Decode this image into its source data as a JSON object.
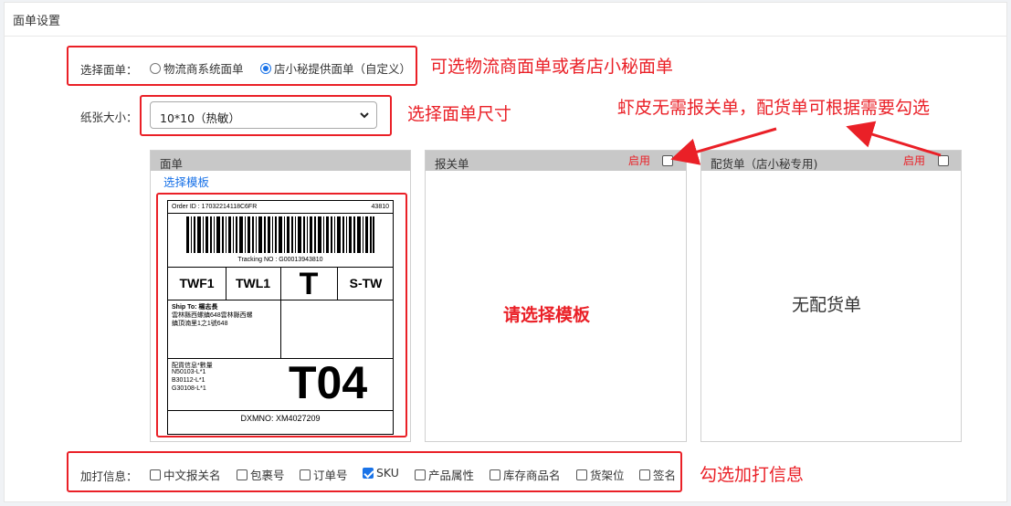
{
  "header": {
    "title": "面单设置"
  },
  "waybill_type": {
    "label": "选择面单：",
    "options": [
      {
        "label": "物流商系统面单",
        "selected": false
      },
      {
        "label": "店小秘提供面单（自定义）",
        "selected": true
      }
    ]
  },
  "paper_size": {
    "label": "纸张大小：",
    "value": "10*10（热敏）"
  },
  "panels": {
    "waybill": {
      "title": "面单",
      "select_template": "选择模板"
    },
    "customs": {
      "title": "报关单",
      "enable": "启用",
      "enabled": false,
      "placeholder": "请选择模板"
    },
    "packing": {
      "title": "配货单（店小秘专用)",
      "enable": "启用",
      "enabled": false,
      "placeholder": "无配货单"
    }
  },
  "label_preview": {
    "order_id": "Order ID : 17032214118C6FR",
    "order_no": "43810",
    "tracking": "Tracking NO : G00013943810",
    "codes": [
      "TWF1",
      "TWL1",
      "T",
      "S-TW"
    ],
    "ship_to_title": "Ship To: 楊志長",
    "ship_to_line1": "雲林縣西螺鎮648雲林縣西螺",
    "ship_to_line2": "鎮頂湳里1之1號648",
    "items_title": "配貨信息*數量",
    "items": [
      "N50103-L*1",
      "B30112-L*1",
      "G30108-L*1"
    ],
    "big_code": "T04",
    "dxm_no": "DXMNO: XM4027209"
  },
  "extra_info": {
    "label": "加打信息：",
    "options": [
      {
        "label": "中文报关名",
        "checked": false
      },
      {
        "label": "包裹号",
        "checked": false
      },
      {
        "label": "订单号",
        "checked": false
      },
      {
        "label": "SKU",
        "checked": true
      },
      {
        "label": "产品属性",
        "checked": false
      },
      {
        "label": "库存商品名",
        "checked": false
      },
      {
        "label": "货架位",
        "checked": false
      },
      {
        "label": "签名",
        "checked": false
      }
    ]
  },
  "annotations": {
    "waybill_type": "可选物流商面单或者店小秘面单",
    "paper_size": "选择面单尺寸",
    "shopee_note": "虾皮无需报关单，配货单可根据需要勾选",
    "extra_info": "勾选加打信息"
  },
  "colors": {
    "annotation_red": "#ea2027",
    "link_blue": "#1a73e8",
    "panel_header": "#c8c8c8"
  }
}
